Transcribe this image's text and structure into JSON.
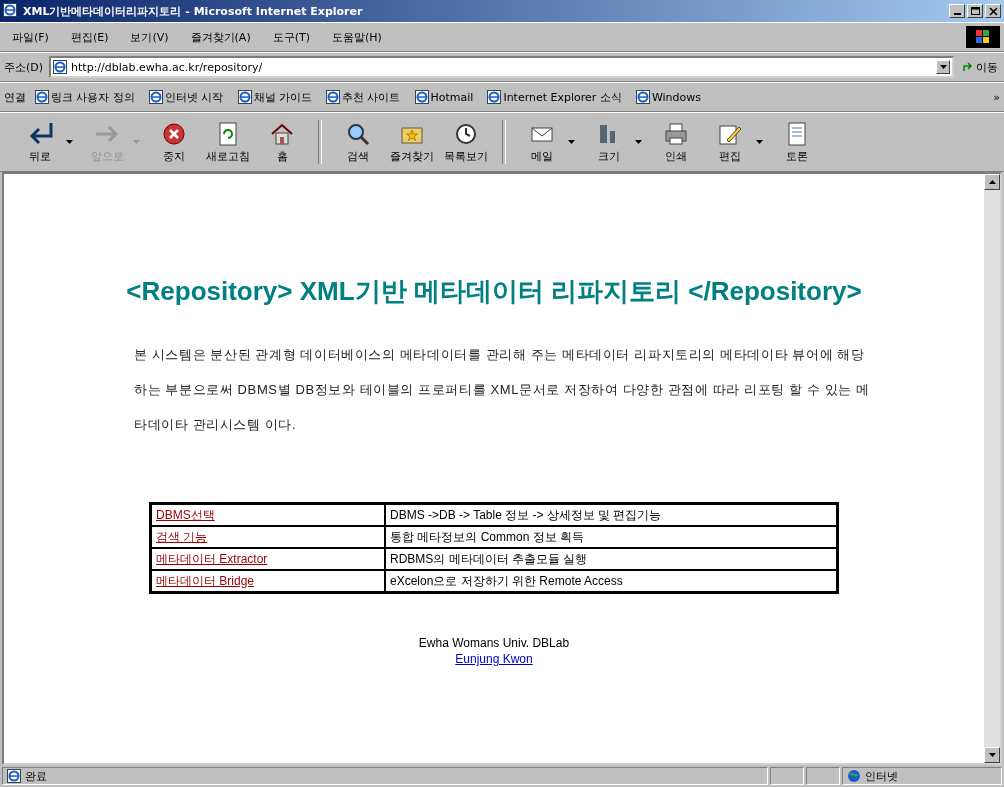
{
  "window": {
    "title": "XML기반메타데이터리파지토리 - Microsoft Internet Explorer"
  },
  "menu": [
    "파일(F)",
    "편집(E)",
    "보기(V)",
    "즐겨찾기(A)",
    "도구(T)",
    "도움말(H)"
  ],
  "address_bar": {
    "label": "주소(D)",
    "value": "http://dblab.ewha.ac.kr/repository/",
    "go": "이동"
  },
  "links_bar": {
    "label": "연결",
    "items": [
      "링크 사용자 정의",
      "인터넷 시작",
      "채널 가이드",
      "추천 사이트",
      "Hotmail",
      "Internet Explorer 소식",
      "Windows"
    ],
    "more": "»"
  },
  "toolbar": [
    {
      "label": "뒤로",
      "disabled": false,
      "dropdown": true
    },
    {
      "label": "앞으로",
      "disabled": true,
      "dropdown": true
    },
    {
      "label": "중지",
      "disabled": false,
      "dropdown": false
    },
    {
      "label": "새로고침",
      "disabled": false,
      "dropdown": false
    },
    {
      "label": "홈",
      "disabled": false,
      "dropdown": false
    },
    {
      "label": "검색",
      "disabled": false,
      "dropdown": false
    },
    {
      "label": "즐겨찾기",
      "disabled": false,
      "dropdown": false
    },
    {
      "label": "목록보기",
      "disabled": false,
      "dropdown": false
    },
    {
      "label": "메일",
      "disabled": false,
      "dropdown": true
    },
    {
      "label": "크기",
      "disabled": false,
      "dropdown": true
    },
    {
      "label": "인쇄",
      "disabled": false,
      "dropdown": false
    },
    {
      "label": "편집",
      "disabled": false,
      "dropdown": true
    },
    {
      "label": "토론",
      "disabled": false,
      "dropdown": false
    }
  ],
  "page": {
    "heading": "<Repository> XML기반 메타데이터 리파지토리 </Repository>",
    "description": "본 시스템은 분산된 관계형 데이터베이스의 메타데이터를 관리해 주는 메타데이터 리파지토리의 메타데이타 뷰어에 해당하는 부분으로써 DBMS별 DB정보와 테이블의 프로퍼티를 XML문서로 저장하여 다양한 관점에 따라 리포팅 할 수 있는 메타데이타 관리시스템 이다.",
    "table": {
      "rows": [
        {
          "link": "DBMS선택",
          "description": "DBMS ->DB -> Table 정보 -> 상세정보 및 편집기능"
        },
        {
          "link": "검색 기능",
          "description": "통합 메타정보의 Common 정보 획득"
        },
        {
          "link": "메타데이터 Extractor",
          "description": "RDBMS의 메타데이터 추출모듈 실행"
        },
        {
          "link": "메타데이터 Bridge",
          "description": "eXcelon으로 저장하기 위한 Remote Access"
        }
      ]
    },
    "footer": {
      "organization": "Ewha Womans Univ. DBLab",
      "author": "Eunjung Kwon"
    }
  },
  "status_bar": {
    "text": "완료",
    "zone": "인터넷"
  }
}
